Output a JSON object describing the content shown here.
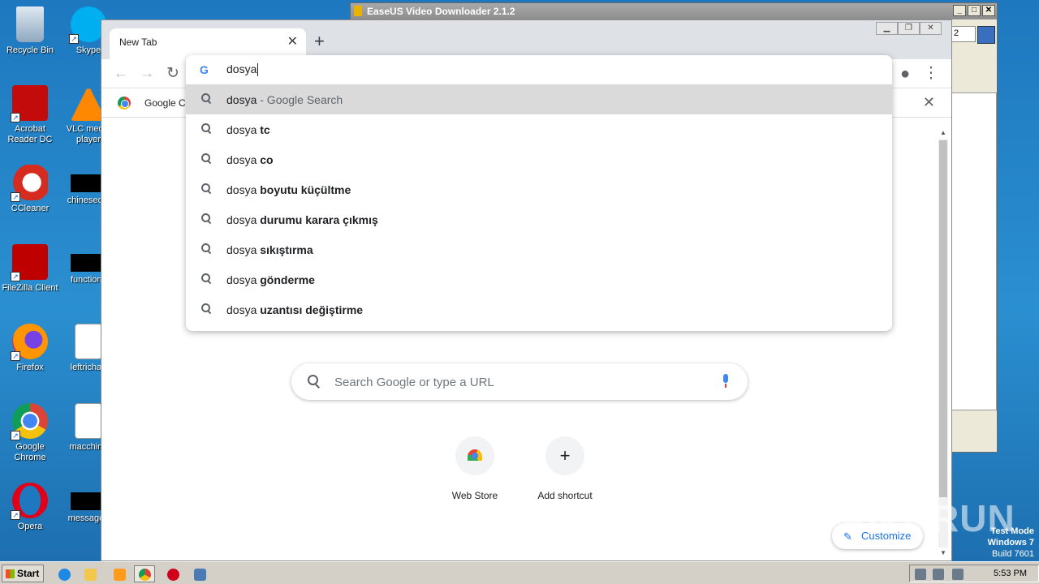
{
  "desktop": {
    "icons": [
      {
        "label": "Recycle Bin"
      },
      {
        "label": "Skype"
      },
      {
        "label": "Acrobat Reader DC"
      },
      {
        "label": "VLC media player"
      },
      {
        "label": "CCleaner"
      },
      {
        "label": "chinesec..."
      },
      {
        "label": "FileZilla Client"
      },
      {
        "label": "functions"
      },
      {
        "label": "Firefox"
      },
      {
        "label": "leftrichan"
      },
      {
        "label": "Google Chrome"
      },
      {
        "label": "macchina"
      },
      {
        "label": "Opera"
      },
      {
        "label": "messageu"
      }
    ]
  },
  "easeus": {
    "title": "EaseUS Video Downloader 2.1.2",
    "field_value": "2"
  },
  "chrome": {
    "tab_title": "New Tab",
    "bookmark_label": "Google Cl",
    "omnibox": {
      "g_logo": "G",
      "query": "dosya",
      "suggestions": [
        {
          "query": "dosya",
          "bold": "",
          "desc": "- Google Search"
        },
        {
          "query": "dosya",
          "bold": "tc",
          "desc": ""
        },
        {
          "query": "dosya",
          "bold": "co",
          "desc": ""
        },
        {
          "query": "dosya",
          "bold": "boyutu küçültme",
          "desc": ""
        },
        {
          "query": "dosya",
          "bold": "durumu karara çıkmış",
          "desc": ""
        },
        {
          "query": "dosya",
          "bold": "sıkıştırma",
          "desc": ""
        },
        {
          "query": "dosya",
          "bold": "gönderme",
          "desc": ""
        },
        {
          "query": "dosya",
          "bold": "uzantısı değiştirme",
          "desc": ""
        }
      ]
    },
    "ntp": {
      "search_placeholder": "Search Google or type a URL",
      "shortcuts": [
        {
          "label": "Web Store"
        },
        {
          "label": "Add shortcut",
          "glyph": "+"
        }
      ],
      "customize_label": "Customize"
    }
  },
  "overlay": {
    "watermark": "ANY RUN",
    "testmode": [
      "Test Mode",
      "Windows 7",
      "Build 7601"
    ]
  },
  "taskbar": {
    "start_label": "Start",
    "clock": "5:53 PM"
  },
  "colors": {
    "accent": "#1a73e8",
    "selected_row": "#dadada",
    "desktop": "#1e78bf"
  }
}
